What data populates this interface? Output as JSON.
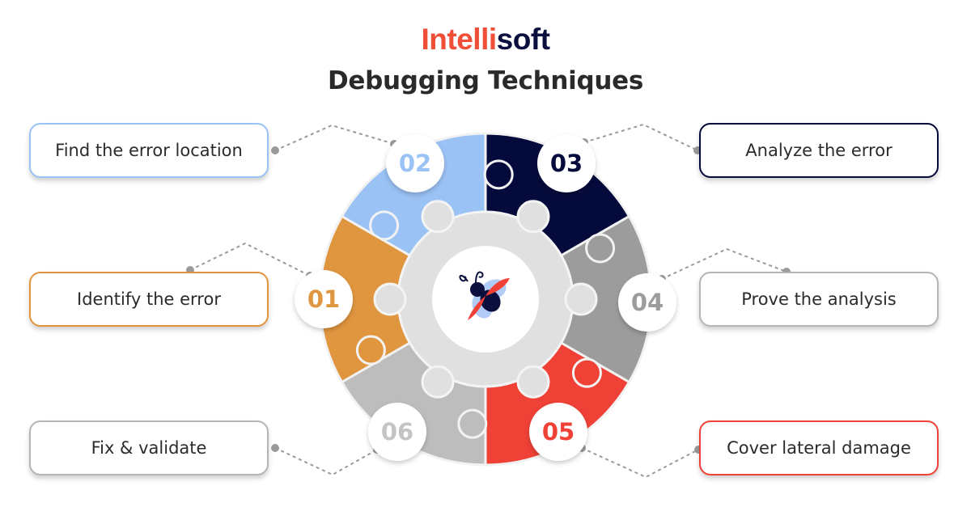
{
  "brand": {
    "part1": "Intelli",
    "part2": "soft",
    "color1": "#f04e37",
    "color2": "#0a0f3d"
  },
  "title": "Debugging Techniques",
  "steps": [
    {
      "number": "01",
      "label": "Identify the error",
      "color": "#e0963f"
    },
    {
      "number": "02",
      "label": "Find the error location",
      "color": "#9bc2f5"
    },
    {
      "number": "03",
      "label": "Analyze the error",
      "color": "#040a3b"
    },
    {
      "number": "04",
      "label": "Prove the analysis",
      "color": "#9c9c9c"
    },
    {
      "number": "05",
      "label": "Cover lateral damage",
      "color": "#ef4136"
    },
    {
      "number": "06",
      "label": "Fix & validate",
      "color": "#bdbdbd"
    }
  ],
  "center": {
    "icon": "ladybug-icon",
    "ring_color": "#e0e0e0"
  },
  "connector_color": "#9a9a9a"
}
